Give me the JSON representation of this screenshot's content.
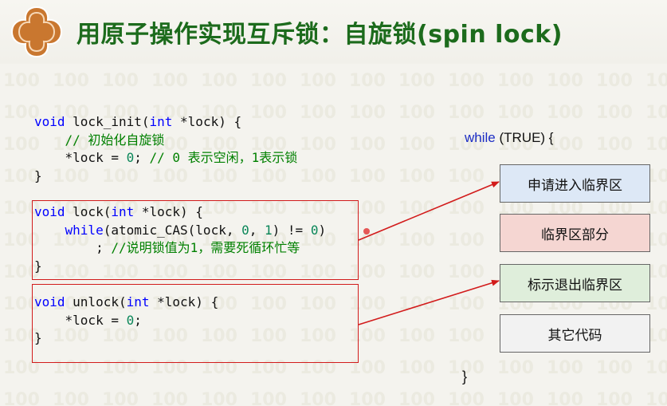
{
  "title": "用原子操作实现互斥锁：自旋锁(spin lock)",
  "code": {
    "init": {
      "l1": {
        "kw": "void",
        "name": " lock_init(",
        "kw2": "int",
        "rest": " *lock) {"
      },
      "l2": "    // 初始化自旋锁",
      "l3": {
        "pre": "    *lock = ",
        "num": "0",
        "mid": "; ",
        "comment": "// 0 表示空闲，1表示锁"
      },
      "l4": "}"
    },
    "lock": {
      "l1": {
        "kw": "void",
        "name": " lock(",
        "kw2": "int",
        "rest": " *lock) {"
      },
      "l2": {
        "indent": "    ",
        "kw": "while",
        "pre": "(atomic_CAS(lock, ",
        "n1": "0",
        "sep": ", ",
        "n2": "1",
        "mid": ") != ",
        "n3": "0",
        "post": ")"
      },
      "l3": {
        "pre": "        ; ",
        "comment": "//说明锁值为1，需要死循环忙等"
      },
      "l4": "}"
    },
    "unlock": {
      "l1": {
        "kw": "void",
        "name": " unlock(",
        "kw2": "int",
        "rest": " *lock) {"
      },
      "l2": {
        "pre": "    *lock = ",
        "num": "0",
        "post": ";"
      },
      "l3": "}"
    }
  },
  "loop": {
    "keyword": "while",
    "condition": " (TRUE) {",
    "close": "}"
  },
  "flow": [
    {
      "label": "申请进入临界区",
      "color": "#dde8f6"
    },
    {
      "label": "临界区部分",
      "color": "#f5d6d2"
    },
    {
      "label": "标示退出临界区",
      "color": "#dfeedb"
    },
    {
      "label": "其它代码",
      "color": "#f2f2f2"
    }
  ],
  "colors": {
    "title": "#1c6b1c",
    "keyword": "#0000ff",
    "comment": "#008000",
    "highlight": "#d21b1b"
  }
}
